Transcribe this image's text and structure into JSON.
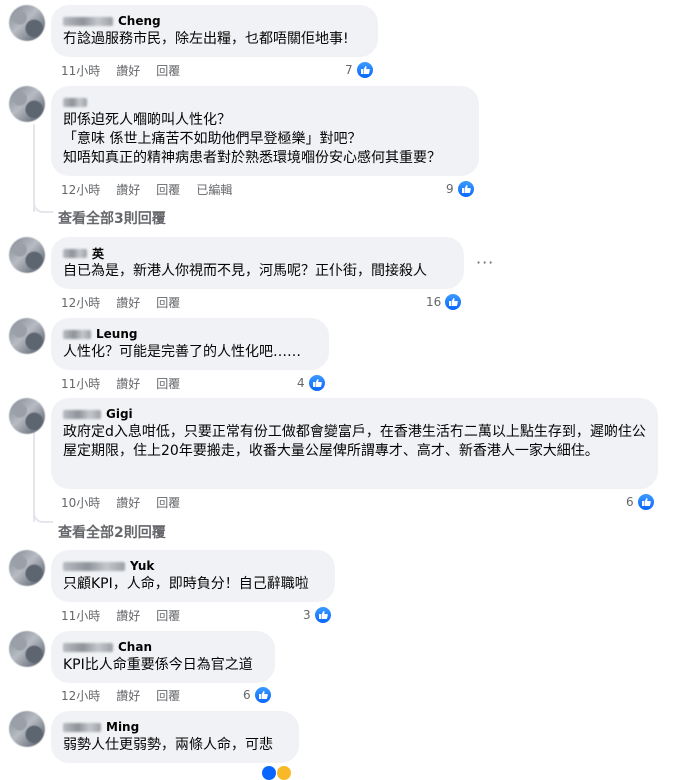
{
  "labels": {
    "like": "讚好",
    "reply": "回覆",
    "edited": "已編輯"
  },
  "comments": [
    {
      "author": "Cheng",
      "text": "冇諗過服務市民，除左出糧，乜都唔關佢地事!",
      "time": "11小時",
      "reactions": "7"
    },
    {
      "author": "",
      "text": "即係迫死人嗰啲叫人性化？\n「意味 係世上痛苦不如助他們早登極樂」對吧？\n知唔知真正的精神病患者對於熟悉環境嗰份安心感何其重要？",
      "time": "12小時",
      "reactions": "9"
    },
    {
      "author": "英",
      "text": "自已為是，新港人你視而不見，河馬呢？正仆街，間接殺人",
      "time": "12小時",
      "reactions": "16"
    },
    {
      "author": "Leung",
      "text": "人性化？可能是完善了的人性化吧……",
      "time": "11小時",
      "reactions": "4"
    },
    {
      "author": "Gigi",
      "text": "政府定d入息咁低，只要正常有份工做都會變富戶，在香港生活冇二萬以上點生存到，遲啲住公屋定期限，住上20年要搬走，收番大量公屋俾所謂專才、高才、新香港人一家大細住。",
      "time": "10小時",
      "reactions": "6"
    },
    {
      "author": "Yuk",
      "text": "只顧KPI，人命，即時負分！自己辭職啦",
      "time": "11小時",
      "reactions": "3"
    },
    {
      "author": "Chan",
      "text": "KPI比人命重要係今日為官之道",
      "time": "12小時",
      "reactions": "6"
    },
    {
      "author": "Ming",
      "text": "弱勢人仕更弱勢，兩條人命，可悲"
    }
  ],
  "view_replies": [
    "查看全部3則回覆",
    "查看全部2則回覆"
  ],
  "more_options": "···",
  "colors": {
    "like_blue": "#0866ff",
    "bubble": "#f0f2f5",
    "meta": "#65676b"
  }
}
